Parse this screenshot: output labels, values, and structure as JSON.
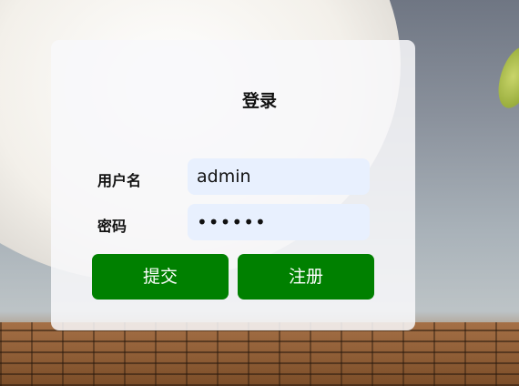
{
  "login": {
    "title": "登录",
    "username_label": "用户名",
    "username_value": "admin",
    "password_label": "密码",
    "password_value": "••••••",
    "submit_label": "提交",
    "register_label": "注册"
  },
  "colors": {
    "button": "#008000",
    "field": "#e8f0fe"
  }
}
